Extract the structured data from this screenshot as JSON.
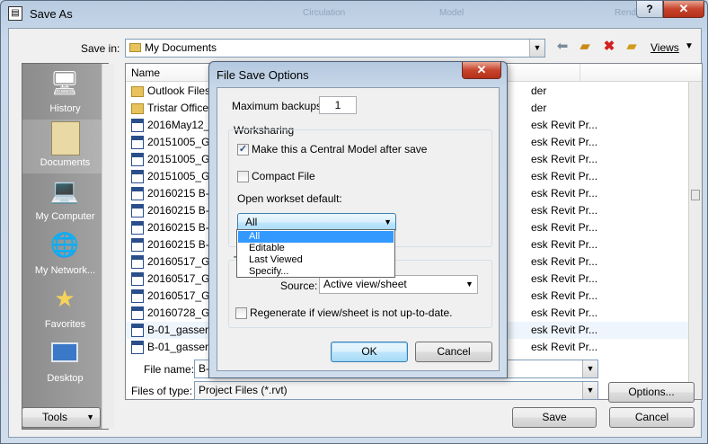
{
  "window": {
    "title": "Save As",
    "ghost_texts": [
      "Circulation",
      "Model",
      "Rend"
    ],
    "help_label": "?",
    "close_label": "✕"
  },
  "toolbar": {
    "save_in_label": "Save in:",
    "save_in_value": "My Documents",
    "views_label": "Views"
  },
  "places": [
    {
      "label": "History",
      "icon": "history-icon"
    },
    {
      "label": "Documents",
      "icon": "documents-icon"
    },
    {
      "label": "My Computer",
      "icon": "computer-icon"
    },
    {
      "label": "My Network...",
      "icon": "network-icon"
    },
    {
      "label": "Favorites",
      "icon": "favorites-icon"
    },
    {
      "label": "Desktop",
      "icon": "desktop-icon"
    }
  ],
  "filelist": {
    "column_name": "Name",
    "rows": [
      {
        "name": "Outlook Files",
        "type": "der",
        "kind": "folder"
      },
      {
        "name": "Tristar Office",
        "type": "der",
        "kind": "folder"
      },
      {
        "name": "2016May12_Ic",
        "type": "esk Revit Pr...",
        "kind": "rvt"
      },
      {
        "name": "20151005_GA",
        "type": "esk Revit Pr...",
        "kind": "rvt"
      },
      {
        "name": "20151005_GA",
        "type": "esk Revit Pr...",
        "kind": "rvt"
      },
      {
        "name": "20151005_GA",
        "type": "esk Revit Pr...",
        "kind": "rvt"
      },
      {
        "name": "20160215 B-0",
        "type": "esk Revit Pr...",
        "kind": "rvt"
      },
      {
        "name": "20160215 B-0",
        "type": "esk Revit Pr...",
        "kind": "rvt"
      },
      {
        "name": "20160215 B-0",
        "type": "esk Revit Pr...",
        "kind": "rvt"
      },
      {
        "name": "20160215 B-0",
        "type": "esk Revit Pr...",
        "kind": "rvt"
      },
      {
        "name": "20160517_GA",
        "type": "esk Revit Pr...",
        "kind": "rvt"
      },
      {
        "name": "20160517_GA",
        "type": "esk Revit Pr...",
        "kind": "rvt"
      },
      {
        "name": "20160517_GA",
        "type": "esk Revit Pr...",
        "kind": "rvt"
      },
      {
        "name": "20160728_GA",
        "type": "esk Revit Pr...",
        "kind": "rvt"
      },
      {
        "name": "B-01_gasser.e",
        "type": "esk Revit Pr...",
        "kind": "rvt"
      },
      {
        "name": "B-01_gasser.e",
        "type": "esk Revit Pr...",
        "kind": "rvt"
      }
    ]
  },
  "footer": {
    "file_name_label": "File name:",
    "file_name_value": "B-",
    "file_type_label": "Files of type:",
    "file_type_value": "Project Files  (*.rvt)",
    "options_label": "Options...",
    "tools_label": "Tools",
    "save_label": "Save",
    "cancel_label": "Cancel"
  },
  "dialog": {
    "title": "File Save Options",
    "close_label": "✕",
    "max_backups_label": "Maximum backups:",
    "max_backups_value": "1",
    "worksharing_label": "Worksharing",
    "central_model_label": "Make this a Central Model after save",
    "central_model_checked": true,
    "compact_label": "Compact File",
    "compact_checked": false,
    "workset_label": "Open workset default:",
    "workset_value": "All",
    "workset_options": [
      "All",
      "Editable",
      "Last Viewed",
      "Specify..."
    ],
    "thumbnail_prefix": "T",
    "source_label": "Source:",
    "source_value": "Active view/sheet",
    "regenerate_label": "Regenerate if view/sheet is not up-to-date.",
    "regenerate_checked": false,
    "ok_label": "OK",
    "cancel_label": "Cancel"
  }
}
